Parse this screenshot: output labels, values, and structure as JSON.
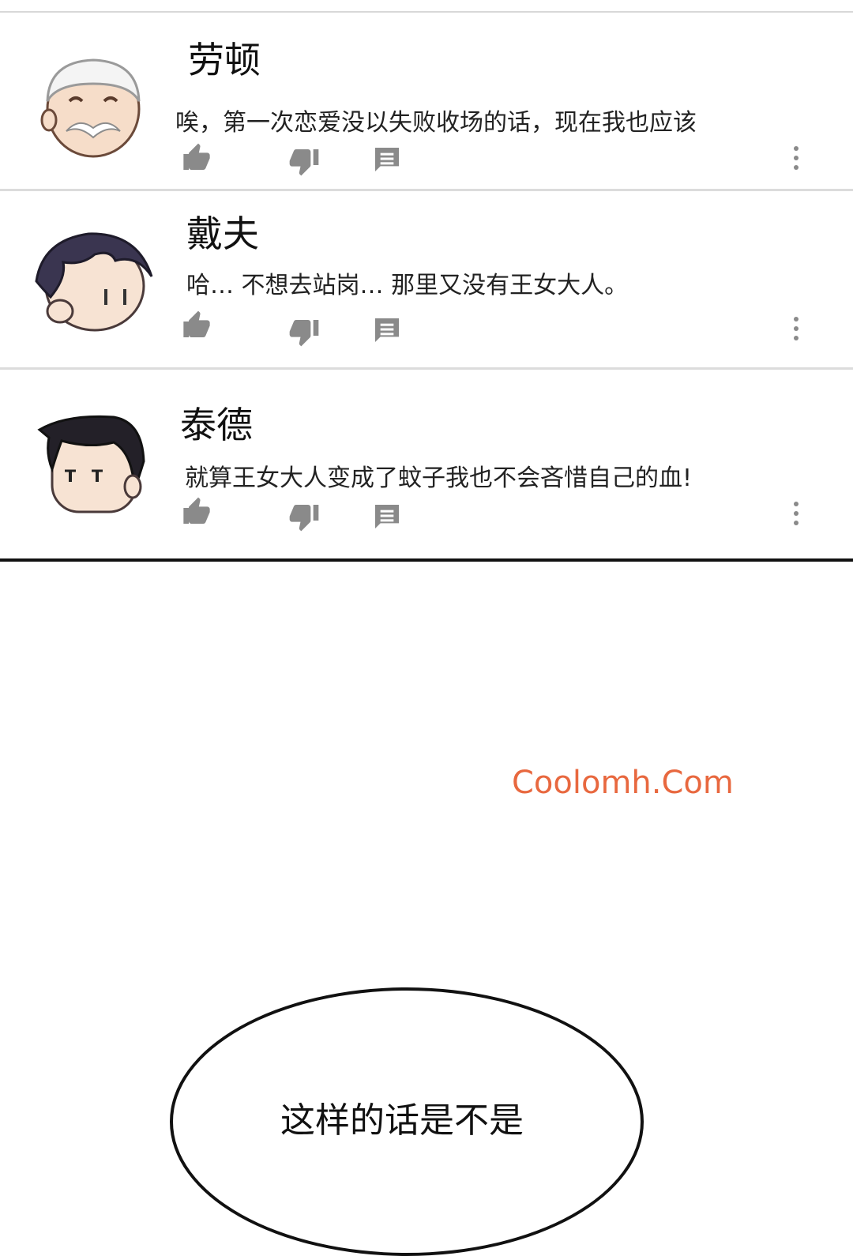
{
  "comments": [
    {
      "author": "劳顿",
      "text": "唉，第一次恋爱没以失败收场的话，现在我也应该",
      "avatar_icon": "white-haired-old-man-avatar-icon"
    },
    {
      "author": "戴夫",
      "text": "哈… 不想去站岗… 那里又没有王女大人。",
      "avatar_icon": "dark-haired-young-man-avatar-icon"
    },
    {
      "author": "泰德",
      "text": "就算王女大人变成了蚊子我也不会吝惜自己的血!",
      "avatar_icon": "black-haired-man-avatar-icon"
    }
  ],
  "icons": {
    "like": "thumbs-up-icon",
    "dislike": "thumbs-down-icon",
    "reply": "reply-icon",
    "more": "more-vertical-icon"
  },
  "colors": {
    "icon_gray": "#8a8a8a",
    "divider": "#dcdcdc",
    "watermark": "#e8683f"
  },
  "watermark": "Coolomh.Com",
  "speech_bubble_text": "这样的话是不是"
}
